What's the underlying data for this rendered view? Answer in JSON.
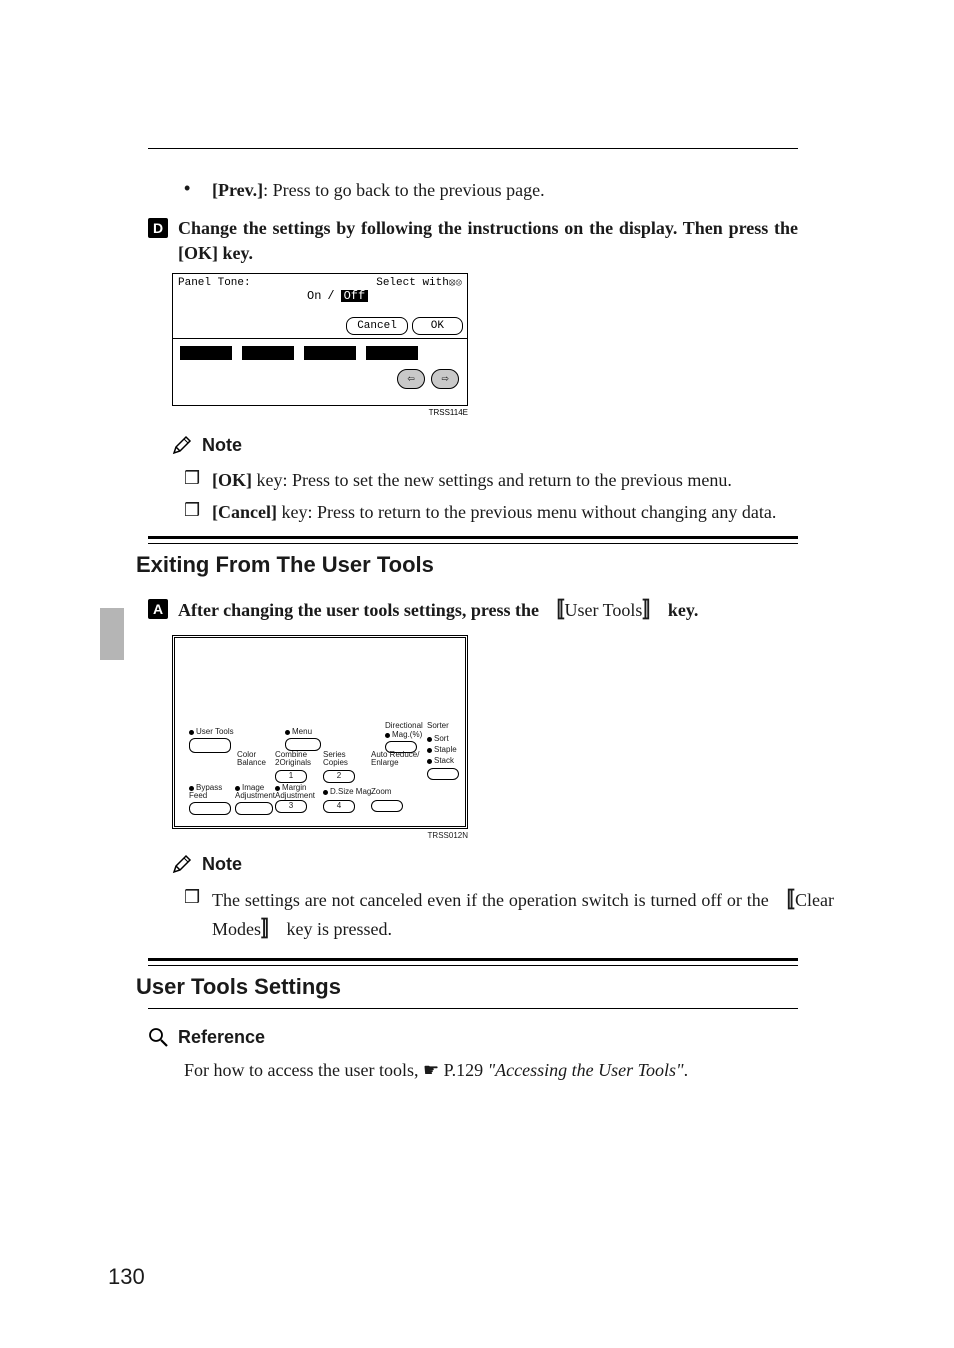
{
  "page_number": "130",
  "intro_bullet": {
    "glyph": "•",
    "prefix": "[Prev.]",
    "text": ": Press to go back to the previous page."
  },
  "step_d": {
    "num": "D",
    "text_pre": "Change the settings by following the instructions on the display. Then press the ",
    "ok": "[OK]",
    "text_post": " key."
  },
  "fig1": {
    "title": "Panel Tone:",
    "hint": "Select with",
    "on": "On",
    "off": "Off",
    "cancel": "Cancel",
    "ok": "OK",
    "code": "TRSS114E"
  },
  "notes_d": {
    "heading": "Note",
    "items": [
      {
        "glyph": "❒",
        "key": "[OK]",
        "text": " key: Press to set the new settings and return to the previous menu."
      },
      {
        "glyph": "❒",
        "key": "[Cancel]",
        "text": " key: Press to return to the previous menu without changing any data."
      }
    ]
  },
  "section_exit": "Exiting From The User Tools",
  "step_a": {
    "num": "A",
    "text_pre": "After changing the user tools settings, press the ",
    "bracket_label": "User Tools",
    "text_post": " key."
  },
  "fig2": {
    "labels": {
      "user_tools": "User Tools",
      "menu": "Menu",
      "directional": "Directional",
      "mag": "Mag.(%)",
      "sorter": "Sorter",
      "sort": "Sort",
      "staple": "Staple",
      "stack": "Stack",
      "color_balance": "Color\nBalance",
      "combine": "Combine\n2Originals",
      "series": "Series\nCopies",
      "auto": "Auto Reduce/\nEnlarge",
      "bypass": "Bypass\nFeed",
      "image": "Image\nAdjustment",
      "margin": "Margin\nAdjustment",
      "dsize": "D.Size Mag.",
      "zoom": "Zoom",
      "k1": "1",
      "k2": "2",
      "k3": "3",
      "k4": "4"
    },
    "code": "TRSS012N"
  },
  "notes_a": {
    "heading": "Note",
    "glyph": "❒",
    "text_pre": "The settings are not canceled even if the operation switch is turned off or the ",
    "bracket_label": "Clear Modes",
    "text_post": " key is pressed."
  },
  "section_settings": "User Tools Settings",
  "reference": {
    "heading": "Reference",
    "text_pre": "For how to access the user tools, ",
    "see": "☛",
    "pageref": " P.129 ",
    "ital": "\"Accessing the User Tools\"",
    "text_post": "."
  }
}
